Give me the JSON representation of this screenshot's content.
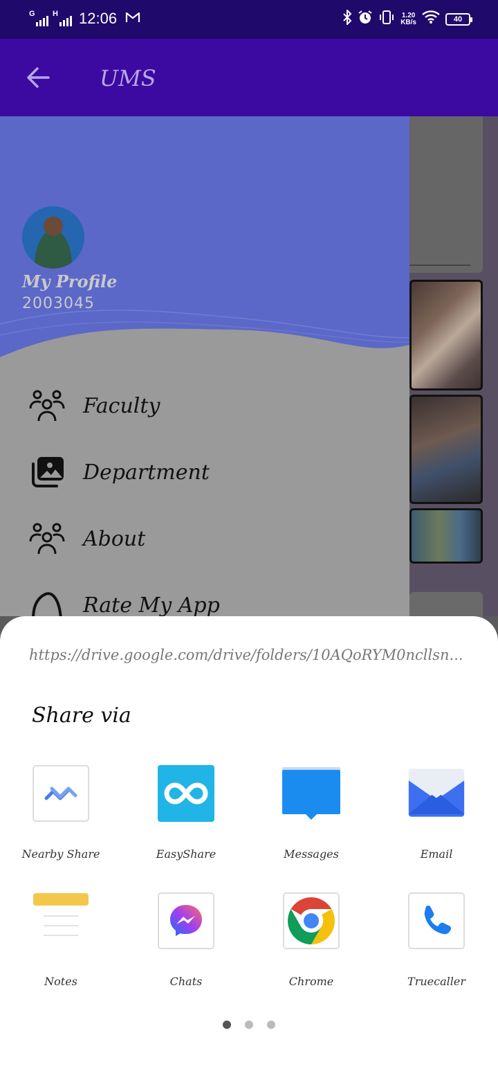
{
  "status_bar": {
    "sim1_label": "G",
    "sim2_label": "H",
    "time": "12:06",
    "mail_icon": "gmail-icon",
    "speed_value": "1.20",
    "speed_unit": "KB/s",
    "battery": "40"
  },
  "app_bar": {
    "back_icon": "arrow-left-icon",
    "title": "UMS",
    "background": "#3c0aa0"
  },
  "drawer": {
    "profile_name": "My Profile",
    "profile_id": "2003045",
    "header_color": "#5b68c8",
    "items": [
      {
        "label": "Faculty",
        "icon": "people-group-icon"
      },
      {
        "label": "Department",
        "icon": "photo-library-icon"
      },
      {
        "label": "About",
        "icon": "people-group-icon"
      },
      {
        "label": "Rate My App",
        "icon": "rate-app-icon"
      }
    ]
  },
  "share_sheet": {
    "url": "https://drive.google.com/drive/folders/10AQoRYM0ncllsn...",
    "title": "Share via",
    "apps": [
      {
        "label": "Nearby Share",
        "icon": "nearby-share-icon"
      },
      {
        "label": "EasyShare",
        "icon": "easyshare-icon"
      },
      {
        "label": "Messages",
        "icon": "messages-icon"
      },
      {
        "label": "Email",
        "icon": "email-icon"
      },
      {
        "label": "Notes",
        "icon": "notes-icon"
      },
      {
        "label": "Chats",
        "icon": "messenger-icon"
      },
      {
        "label": "Chrome",
        "icon": "chrome-icon"
      },
      {
        "label": "Truecaller",
        "icon": "truecaller-icon"
      }
    ],
    "page_count": 3,
    "current_page": 1
  }
}
